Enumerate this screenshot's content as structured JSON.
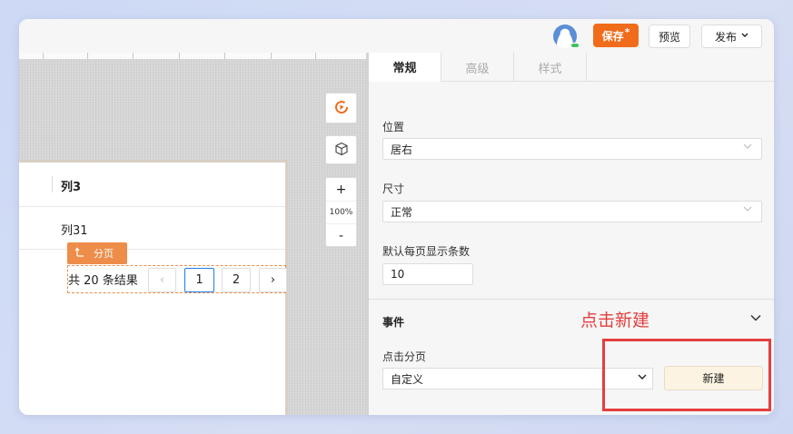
{
  "topbar": {
    "save_label": "保存",
    "save_marker": "*",
    "preview_label": "预览",
    "publish_label": "发布",
    "publish_chevron": "⌄"
  },
  "canvas": {
    "zoom_plus": "+",
    "zoom_level": "100%",
    "zoom_minus": "-",
    "table": {
      "header": "列3",
      "cell": "列31"
    },
    "pager_tag": "分页",
    "pager": {
      "total": "共 20 条结果",
      "prev": "‹",
      "pages": [
        "1",
        "2"
      ],
      "next": "›"
    }
  },
  "panel": {
    "tabs": [
      "常规",
      "高级",
      "样式"
    ],
    "position_label": "位置",
    "position_value": "居右",
    "size_label": "尺寸",
    "size_value": "正常",
    "page_size_label": "默认每页显示条数",
    "page_size_value": "10",
    "events_title": "事件",
    "annotation": "点击新建",
    "event_label": "点击分页",
    "event_value": "自定义",
    "new_button": "新建"
  },
  "colors": {
    "accent": "#f06b1a",
    "selection": "#ee8d4a",
    "annotation": "#e53e3e",
    "active_page": "#1f7de0"
  },
  "icons": [
    "avatar-icon",
    "play-icon",
    "cube-icon",
    "chevron-down-icon",
    "return-arrow-icon"
  ]
}
